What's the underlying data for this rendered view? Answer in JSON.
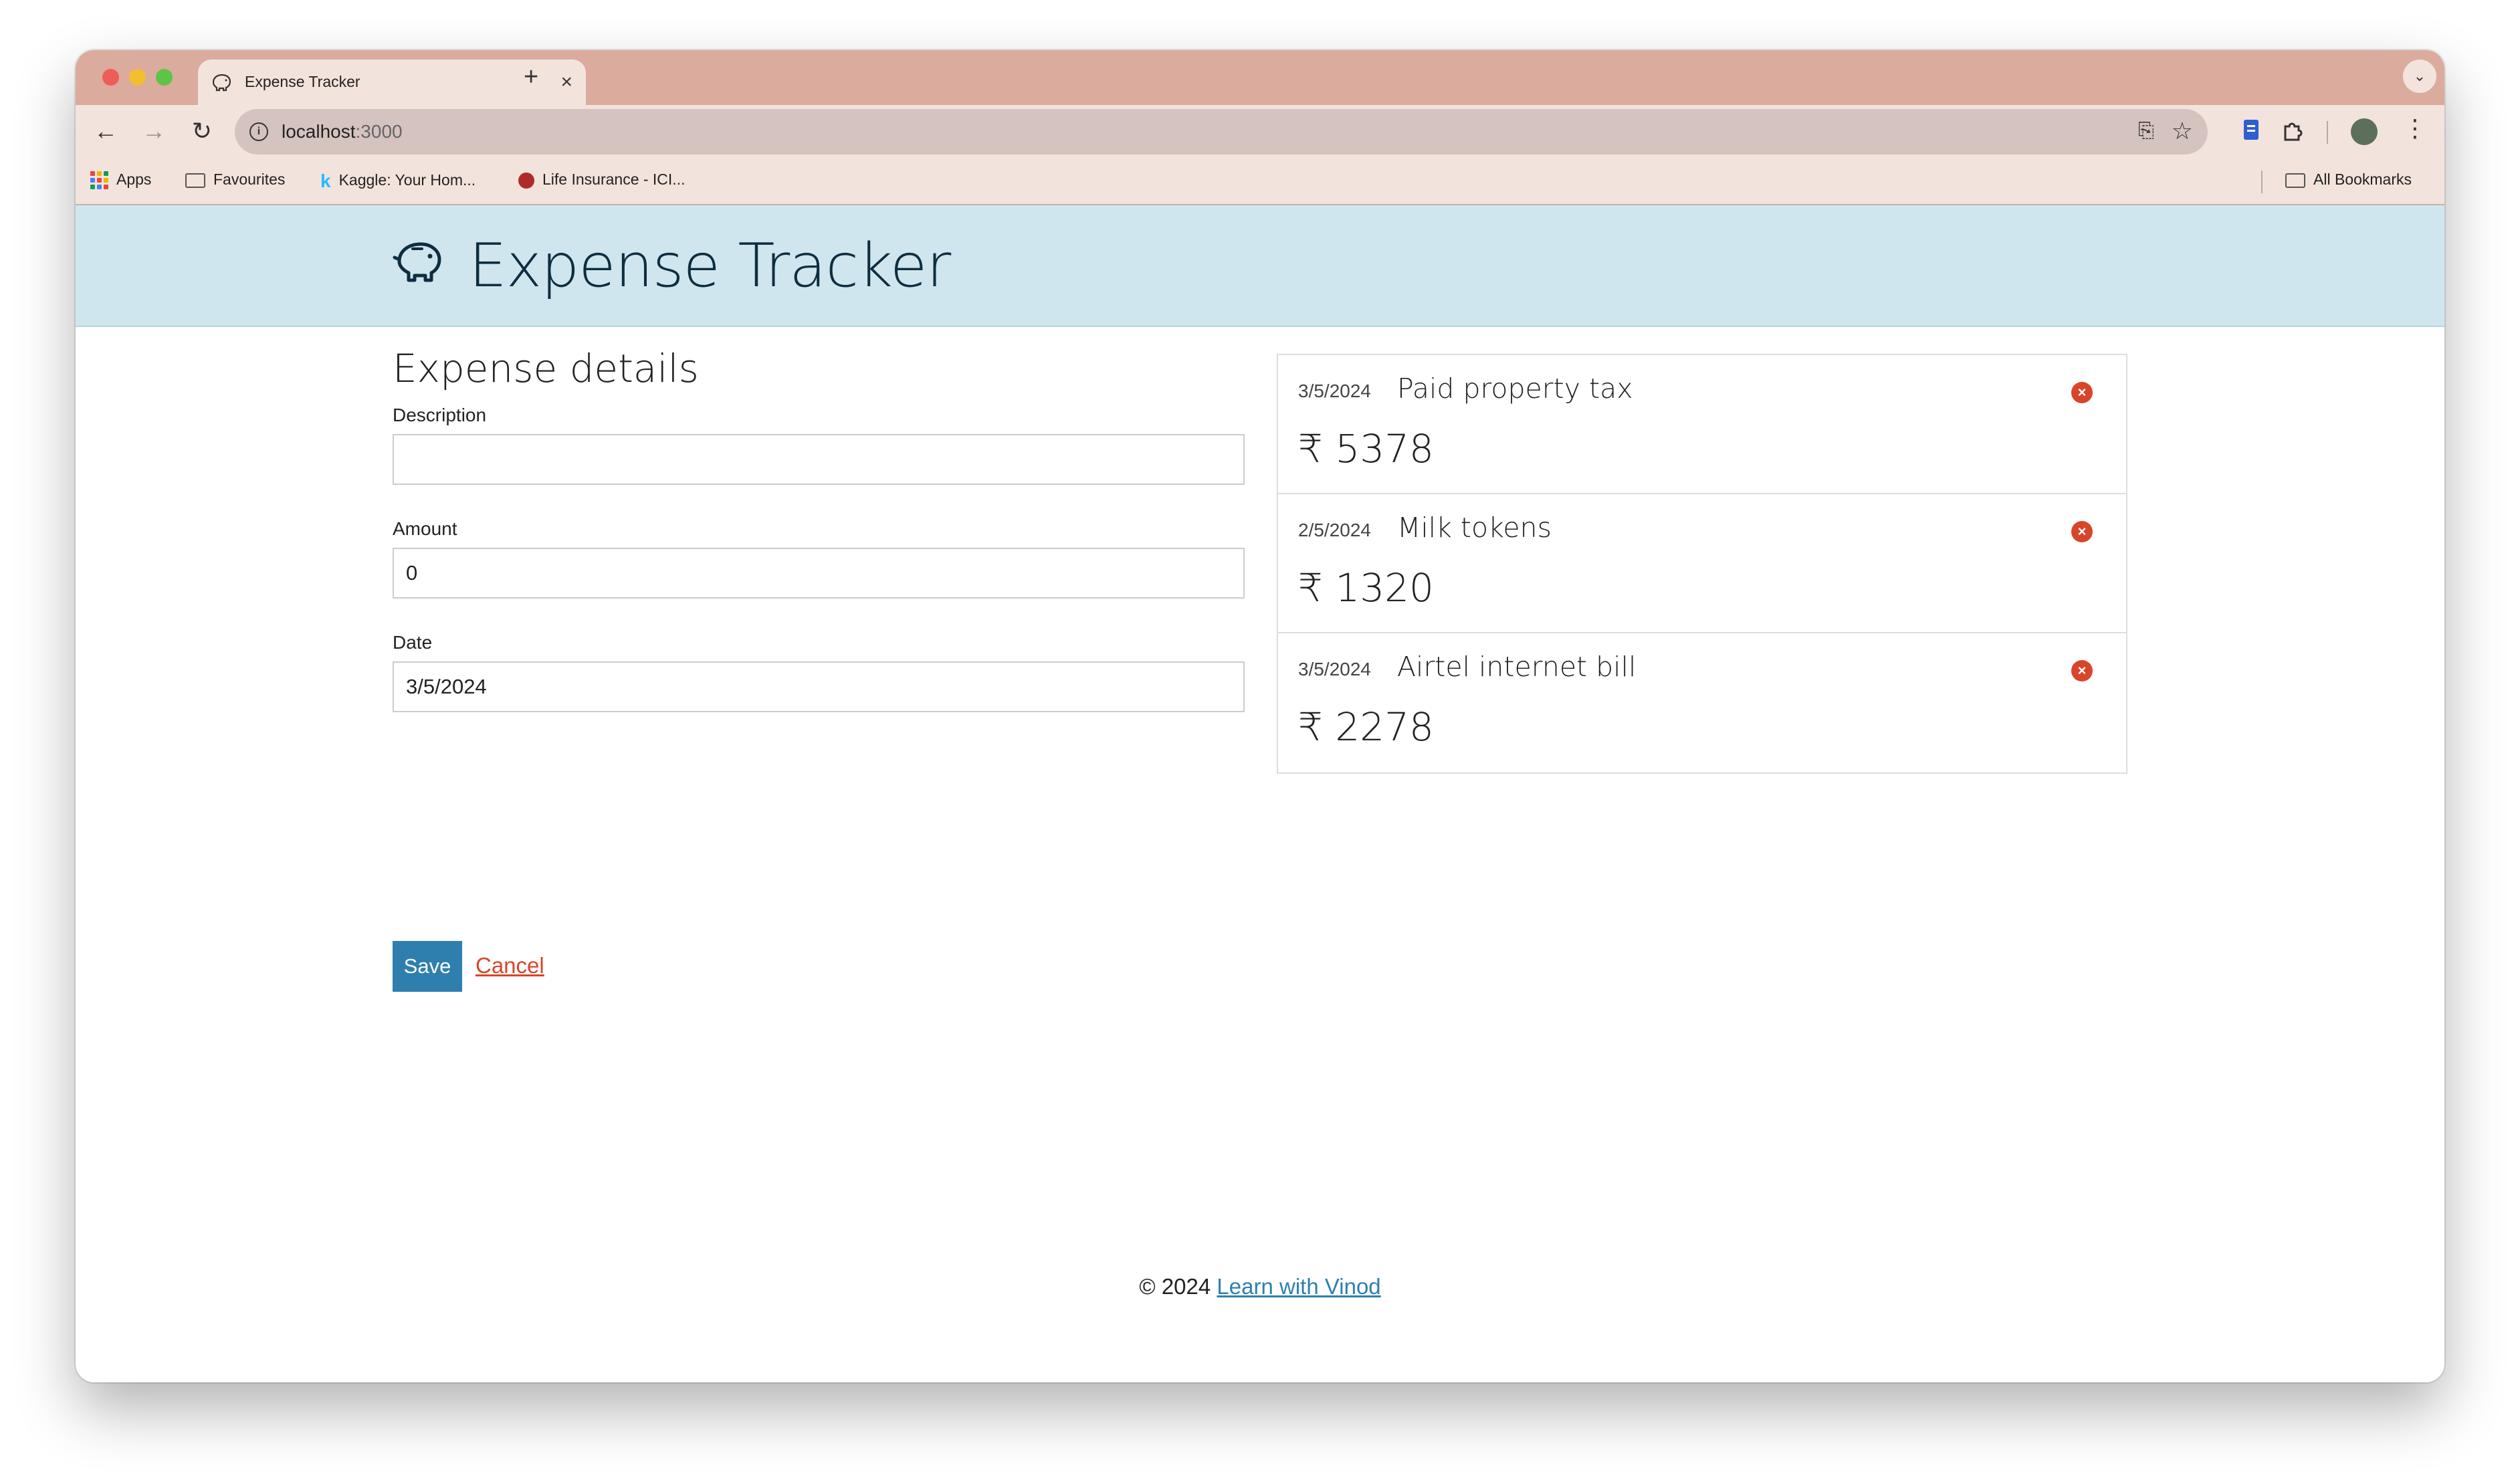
{
  "browser": {
    "tab_title": "Expense Tracker",
    "tab_close": "×",
    "new_tab": "+",
    "url_host": "localhost",
    "url_port": ":3000",
    "bookmarks": [
      {
        "label": "Apps",
        "icon": "apps-grid-icon"
      },
      {
        "label": "Favourites",
        "icon": "folder-icon"
      },
      {
        "label": "Kaggle: Your Hom...",
        "icon": "kaggle-icon"
      },
      {
        "label": "Life Insurance - ICI...",
        "icon": "insurance-icon"
      },
      {
        "label": "All Bookmarks",
        "icon": "folder-icon"
      }
    ],
    "colors": {
      "tabstrip": "#dbab9d",
      "toolbar": "#f3e3dd"
    }
  },
  "app": {
    "title": "Expense Tracker",
    "header_color": "#cfe6ef",
    "accent": "#2f7fae",
    "danger": "#d9452a"
  },
  "form": {
    "heading": "Expense details",
    "description_label": "Description",
    "description_value": "",
    "amount_label": "Amount",
    "amount_value": "0",
    "date_label": "Date",
    "date_value": "3/5/2024",
    "save_label": "Save",
    "cancel_label": "Cancel"
  },
  "expenses": [
    {
      "date": "3/5/2024",
      "description": "Paid property tax",
      "amount": "₹ 5378"
    },
    {
      "date": "2/5/2024",
      "description": "Milk tokens",
      "amount": "₹ 1320"
    },
    {
      "date": "3/5/2024",
      "description": "Airtel internet bill",
      "amount": "₹ 2278"
    }
  ],
  "footer": {
    "copyright": "© 2024",
    "link_label": "Learn with Vinod"
  }
}
